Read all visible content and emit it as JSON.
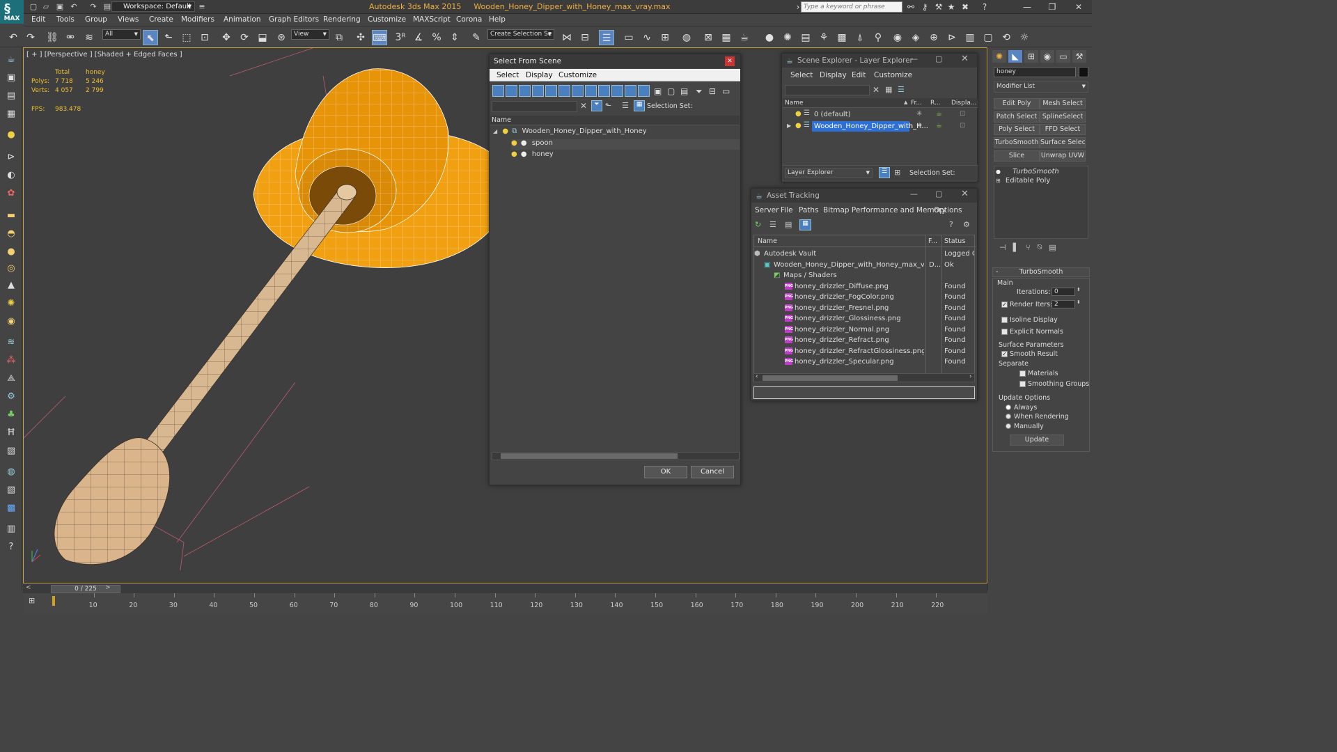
{
  "titlebar": {
    "workspace": "Workspace: Default",
    "app_name": "Autodesk 3ds Max  2015",
    "file_name": "Wooden_Honey_Dipper_with_Honey_max_vray.max",
    "search_placeholder": "Type a keyword or phrase"
  },
  "logo": "MAX",
  "menu": [
    "Edit",
    "Tools",
    "Group",
    "Views",
    "Create",
    "Modifiers",
    "Animation",
    "Graph Editors",
    "Rendering",
    "Customize",
    "MAXScript",
    "Corona",
    "Help"
  ],
  "toolbar": {
    "filter": "All",
    "refcoord": "View",
    "selection_set": "Create Selection Se",
    "snap_3": "3"
  },
  "viewport": {
    "label": "[ + ] [Perspective ] [Shaded + Edged Faces ]",
    "stats": {
      "col_total": "Total",
      "col_obj": "honey",
      "polys_label": "Polys:",
      "polys_total": "7 718",
      "polys_obj": "5 246",
      "verts_label": "Verts:",
      "verts_total": "4 057",
      "verts_obj": "2 799",
      "fps_label": "FPS:",
      "fps": "983.478"
    }
  },
  "timeline": {
    "slider": "0 / 225",
    "ticks": [
      "10",
      "20",
      "30",
      "40",
      "50",
      "60",
      "70",
      "80",
      "90",
      "100",
      "110",
      "120",
      "130",
      "140",
      "150",
      "160",
      "170",
      "180",
      "190",
      "200",
      "210",
      "220"
    ]
  },
  "select_from_scene": {
    "title": "Select From Scene",
    "menu": [
      "Select",
      "Display",
      "Customize"
    ],
    "selection_set_label": "Selection Set:",
    "col_name": "Name",
    "root": "Wooden_Honey_Dipper_with_Honey",
    "children": [
      "spoon",
      "honey"
    ],
    "ok": "OK",
    "cancel": "Cancel"
  },
  "scene_explorer": {
    "title": "Scene Explorer - Layer Explorer",
    "menu": [
      "Select",
      "Display",
      "Edit",
      "Customize"
    ],
    "cols": [
      "Name",
      "Fr...",
      "R...",
      "Displa..."
    ],
    "rows": [
      "0 (default)",
      "Wooden_Honey_Dipper_with_H..."
    ],
    "footer_mode": "Layer Explorer",
    "footer_selset": "Selection Set:"
  },
  "asset_tracking": {
    "title": "Asset Tracking",
    "menu": [
      "Server",
      "File",
      "Paths",
      "Bitmap Performance and Memory",
      "Options"
    ],
    "col_name": "Name",
    "col_f": "F...",
    "col_status": "Status",
    "rows": [
      {
        "name": "Autodesk Vault",
        "f": "",
        "status": "Logged Ou"
      },
      {
        "name": "Wooden_Honey_Dipper_with_Honey_max_v...",
        "f": "D...",
        "status": "Ok"
      },
      {
        "name": "Maps / Shaders",
        "f": "",
        "status": ""
      },
      {
        "name": "honey_drizzler_Diffuse.png",
        "f": "",
        "status": "Found"
      },
      {
        "name": "honey_drizzler_FogColor.png",
        "f": "",
        "status": "Found"
      },
      {
        "name": "honey_drizzler_Fresnel.png",
        "f": "",
        "status": "Found"
      },
      {
        "name": "honey_drizzler_Glossiness.png",
        "f": "",
        "status": "Found"
      },
      {
        "name": "honey_drizzler_Normal.png",
        "f": "",
        "status": "Found"
      },
      {
        "name": "honey_drizzler_Refract.png",
        "f": "",
        "status": "Found"
      },
      {
        "name": "honey_drizzler_RefractGlossiness.png",
        "f": "",
        "status": "Found"
      },
      {
        "name": "honey_drizzler_Specular.png",
        "f": "",
        "status": "Found"
      }
    ]
  },
  "command_panel": {
    "object_name": "honey",
    "modifier_list": "Modifier List",
    "buttons": [
      "Edit Poly",
      "Mesh Select",
      "Patch Select",
      "SplineSelect",
      "Poly Select",
      "FFD Select",
      "TurboSmooth",
      "Surface Select",
      "Slice",
      "Unwrap UVW"
    ],
    "stack": [
      "TurboSmooth",
      "Editable Poly"
    ],
    "rollout_title": "TurboSmooth",
    "main_label": "Main",
    "iterations_label": "Iterations:",
    "iterations": "0",
    "render_iters_label": "Render Iters:",
    "render_iters": "2",
    "isoline": "Isoline Display",
    "explicit_normals": "Explicit Normals",
    "surface_params": "Surface Parameters",
    "smooth_result": "Smooth Result",
    "separate": "Separate",
    "materials": "Materials",
    "smoothing_groups": "Smoothing Groups",
    "update_options": "Update Options",
    "always": "Always",
    "when_rendering": "When Rendering",
    "manually": "Manually",
    "update": "Update"
  }
}
